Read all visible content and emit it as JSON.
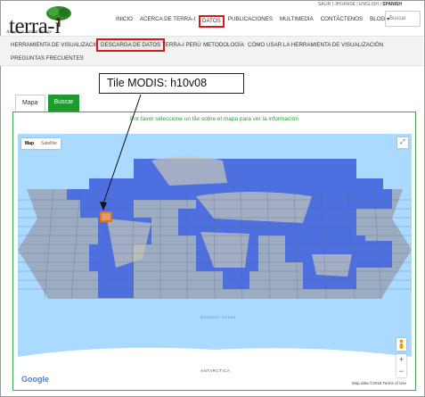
{
  "topbar": {
    "login": "SALIR | JHOANSE",
    "lang_en": "ENGLISH",
    "lang_es": "SPANISH"
  },
  "brand": {
    "name": "terra-i",
    "tagline": "An eye on habitat change"
  },
  "nav": [
    {
      "label": "INICIO",
      "highlight": false
    },
    {
      "label": "ACERCA DE TERRA-I",
      "highlight": false
    },
    {
      "label": "DATOS",
      "highlight": true
    },
    {
      "label": "PUBLICACIONES",
      "highlight": false
    },
    {
      "label": "MULTIMEDIA",
      "highlight": false
    },
    {
      "label": "CONTÁCTENOS",
      "highlight": false
    },
    {
      "label": "BLOG ▾",
      "highlight": false
    }
  ],
  "search": {
    "placeholder": "Buscar"
  },
  "subnav": {
    "item1": "HERRAMIENTA DE VISUALIZACIÓN",
    "item2": "DESCARGA DE DATOS",
    "item3": "TERRA-I PERÚ",
    "item4": "METODOLOGÍA",
    "item5": "CÓMO USAR LA HERRAMIENTA DE VISUALIZACIÓN",
    "item6": "PREGUNTAS FRECUENTES"
  },
  "callout": {
    "text": "Tile MODIS: h10v08"
  },
  "tabs": {
    "map": "Mapa",
    "search": "Buscar"
  },
  "instruction": "Por favor seleccione un tile sobre el mapa para ver la información",
  "map": {
    "type_map": "Map",
    "type_satellite": "Satellite",
    "ocean_label": "Southern Ocean",
    "continent_label": "ANTARCTICA",
    "attribution": "Map data ©2016",
    "terms": "Terms of Use",
    "google": "Google",
    "zoom_in": "+",
    "zoom_out": "−",
    "fullscreen": "⤢"
  },
  "colors": {
    "highlight": "#d61a1a",
    "accent_green": "#1f9a2f",
    "tile_blue": "#4d6fe0",
    "ocean": "#aadaff"
  }
}
